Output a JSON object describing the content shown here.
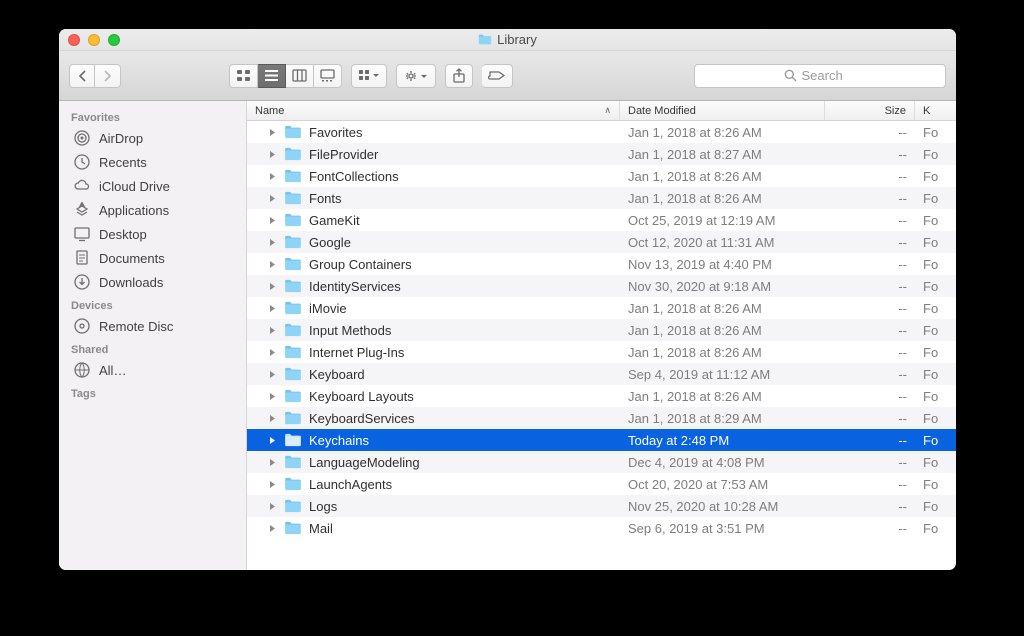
{
  "window": {
    "title": "Library"
  },
  "toolbar": {
    "search_placeholder": "Search"
  },
  "sidebar": {
    "sections": [
      {
        "title": "Favorites",
        "items": [
          {
            "icon": "airdrop",
            "label": "AirDrop"
          },
          {
            "icon": "recents",
            "label": "Recents"
          },
          {
            "icon": "icloud",
            "label": "iCloud Drive"
          },
          {
            "icon": "apps",
            "label": "Applications"
          },
          {
            "icon": "desktop",
            "label": "Desktop"
          },
          {
            "icon": "documents",
            "label": "Documents"
          },
          {
            "icon": "downloads",
            "label": "Downloads"
          }
        ]
      },
      {
        "title": "Devices",
        "items": [
          {
            "icon": "disc",
            "label": "Remote Disc"
          }
        ]
      },
      {
        "title": "Shared",
        "items": [
          {
            "icon": "network",
            "label": "All…"
          }
        ]
      },
      {
        "title": "Tags",
        "items": []
      }
    ]
  },
  "columns": {
    "name": "Name",
    "date": "Date Modified",
    "size": "Size",
    "kind": "K"
  },
  "rows": [
    {
      "name": "Favorites",
      "date": "Jan 1, 2018 at 8:26 AM",
      "size": "--",
      "kind": "Fo",
      "selected": false
    },
    {
      "name": "FileProvider",
      "date": "Jan 1, 2018 at 8:27 AM",
      "size": "--",
      "kind": "Fo",
      "selected": false
    },
    {
      "name": "FontCollections",
      "date": "Jan 1, 2018 at 8:26 AM",
      "size": "--",
      "kind": "Fo",
      "selected": false
    },
    {
      "name": "Fonts",
      "date": "Jan 1, 2018 at 8:26 AM",
      "size": "--",
      "kind": "Fo",
      "selected": false
    },
    {
      "name": "GameKit",
      "date": "Oct 25, 2019 at 12:19 AM",
      "size": "--",
      "kind": "Fo",
      "selected": false
    },
    {
      "name": "Google",
      "date": "Oct 12, 2020 at 11:31 AM",
      "size": "--",
      "kind": "Fo",
      "selected": false
    },
    {
      "name": "Group Containers",
      "date": "Nov 13, 2019 at 4:40 PM",
      "size": "--",
      "kind": "Fo",
      "selected": false
    },
    {
      "name": "IdentityServices",
      "date": "Nov 30, 2020 at 9:18 AM",
      "size": "--",
      "kind": "Fo",
      "selected": false
    },
    {
      "name": "iMovie",
      "date": "Jan 1, 2018 at 8:26 AM",
      "size": "--",
      "kind": "Fo",
      "selected": false
    },
    {
      "name": "Input Methods",
      "date": "Jan 1, 2018 at 8:26 AM",
      "size": "--",
      "kind": "Fo",
      "selected": false
    },
    {
      "name": "Internet Plug-Ins",
      "date": "Jan 1, 2018 at 8:26 AM",
      "size": "--",
      "kind": "Fo",
      "selected": false
    },
    {
      "name": "Keyboard",
      "date": "Sep 4, 2019 at 11:12 AM",
      "size": "--",
      "kind": "Fo",
      "selected": false
    },
    {
      "name": "Keyboard Layouts",
      "date": "Jan 1, 2018 at 8:26 AM",
      "size": "--",
      "kind": "Fo",
      "selected": false
    },
    {
      "name": "KeyboardServices",
      "date": "Jan 1, 2018 at 8:29 AM",
      "size": "--",
      "kind": "Fo",
      "selected": false
    },
    {
      "name": "Keychains",
      "date": "Today at 2:48 PM",
      "size": "--",
      "kind": "Fo",
      "selected": true
    },
    {
      "name": "LanguageModeling",
      "date": "Dec 4, 2019 at 4:08 PM",
      "size": "--",
      "kind": "Fo",
      "selected": false
    },
    {
      "name": "LaunchAgents",
      "date": "Oct 20, 2020 at 7:53 AM",
      "size": "--",
      "kind": "Fo",
      "selected": false
    },
    {
      "name": "Logs",
      "date": "Nov 25, 2020 at 10:28 AM",
      "size": "--",
      "kind": "Fo",
      "selected": false
    },
    {
      "name": "Mail",
      "date": "Sep 6, 2019 at 3:51 PM",
      "size": "--",
      "kind": "Fo",
      "selected": false
    }
  ]
}
